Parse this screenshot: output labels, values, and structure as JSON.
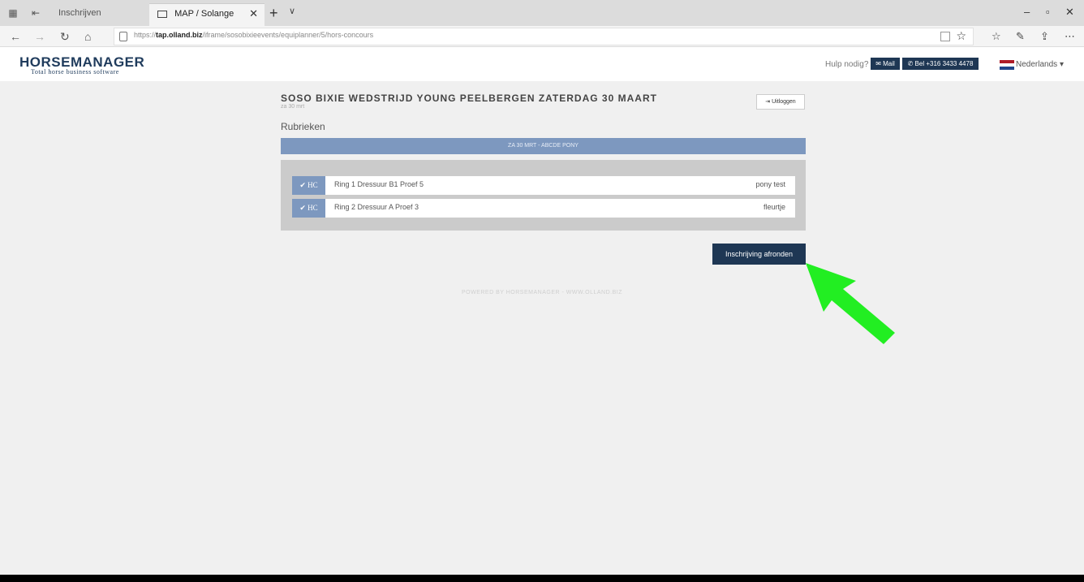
{
  "browser": {
    "tabs": [
      {
        "label": "Inschrijven wedstrijden"
      },
      {
        "label": "MAP / Solange Herman"
      }
    ],
    "url_prefix": "https://",
    "url_domain": "tap.olland.biz",
    "url_path": "/iframe/sosobixieevents/equiplanner/5/hors-concours",
    "icons": [
      "back-icon",
      "forward-icon",
      "refresh-icon",
      "home-icon",
      "lock-icon",
      "reader-icon",
      "star-icon",
      "favorites-icon",
      "pen-icon",
      "share-icon",
      "more-icon"
    ]
  },
  "header": {
    "logo_main": "HORSEMANAGER",
    "logo_sub": "Total horse business software",
    "help_text": "Hulp nodig?",
    "mail_label": "Mail",
    "call_label": "Bel +316 3433 4478",
    "language": "Nederlands"
  },
  "event": {
    "title": "SOSO BIXIE WEDSTRIJD YOUNG PEELBERGEN ZATERDAG 30 MAART",
    "date": "za 30 mrt",
    "logout_label": "Uitloggen"
  },
  "rubrieken": {
    "label": "Rubrieken",
    "category": "ZA 30 MRT - ABCDE PONY",
    "entries": [
      {
        "badge": "HC",
        "name": "Ring 1 Dressuur B1 Proef 5",
        "horse": "pony test"
      },
      {
        "badge": "HC",
        "name": "Ring 2 Dressuur A Proef 3",
        "horse": "fleurtje"
      }
    ]
  },
  "actions": {
    "finish_label": "Inschrijving afronden"
  },
  "footer": {
    "powered": "POWERED BY HORSEMANAGER - WWW.OLLAND.BIZ"
  },
  "colors": {
    "navy": "#1e3754",
    "blue": "#7d98bf",
    "arrow": "#22ee22"
  }
}
